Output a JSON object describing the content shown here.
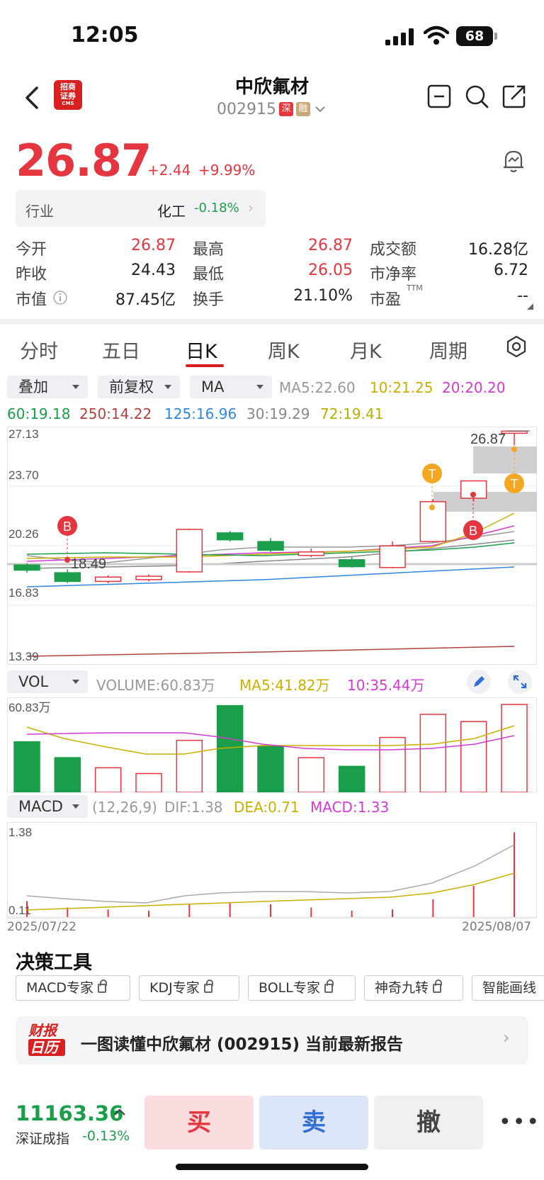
{
  "status": {
    "time": "12:05",
    "battery": "68"
  },
  "header": {
    "logo_top": "招商",
    "logo_mid": "证券",
    "logo_bot": "CMS",
    "title": "中欣氟材",
    "code": "002915",
    "tag1": "深",
    "tag2": "融"
  },
  "quote": {
    "price": "26.87",
    "change": "+2.44",
    "change_pct": "+9.99%"
  },
  "industry": {
    "label": "行业",
    "name": "化工",
    "change": "-0.18%"
  },
  "stats": [
    {
      "k1": "今开",
      "v1": "26.87",
      "k2": "最高",
      "v2": "26.87",
      "k3": "成交额",
      "v3": "16.28亿"
    },
    {
      "k1": "昨收",
      "v1": "24.43",
      "k2": "最低",
      "v2": "26.05",
      "k3": "市净率",
      "v3": "6.72"
    },
    {
      "k1": "市值",
      "v1": "87.45亿",
      "k2": "换手",
      "v2": "21.10%",
      "k3": "市盈",
      "k3sup": "TTM",
      "v3": "--"
    }
  ],
  "tabs": [
    "分时",
    "五日",
    "日K",
    "周K",
    "月K",
    "周期"
  ],
  "controls": {
    "overlay": "叠加",
    "adjust": "前复权",
    "ind": "MA"
  },
  "ma_line1": {
    "ma5": "MA5:22.60",
    "ma10": "10:21.25",
    "ma20": "20:20.20"
  },
  "ma_line2": {
    "ma60": "60:19.18",
    "ma250": "250:14.22",
    "ma125": "125:16.96",
    "ma30": "30:19.29",
    "ma72": "72:19.41"
  },
  "kchart": {
    "y_labels": [
      "27.13",
      "23.70",
      "20.26",
      "16.83",
      "13.39"
    ],
    "high_label": "26.87",
    "low_label": "18.49",
    "marker_b": "B",
    "marker_t": "T"
  },
  "vol": {
    "select": "VOL",
    "volume": "VOLUME:60.83万",
    "ma5": "MA5:41.82万",
    "ma10": "10:35.44万",
    "max_label": "60.83万"
  },
  "macd": {
    "select": "MACD",
    "params": "(12,26,9)",
    "dif": "DIF:1.38",
    "dea": "DEA:0.71",
    "macd": "MACD:1.33",
    "top_label": "1.38",
    "bottom_label": "0.11",
    "date_start": "2025/07/22",
    "date_end": "2025/08/07"
  },
  "tools": {
    "title": "决策工具",
    "items": [
      "MACD专家",
      "KDJ专家",
      "BOLL专家",
      "神奇九转",
      "智能画线"
    ]
  },
  "report": {
    "logo1": "财报",
    "logo2": "日历",
    "text": "一图读懂中欣氟材 (002915) 当前最新报告"
  },
  "index": {
    "value": "11163.36",
    "name": "深证成指",
    "change": "-0.13%"
  },
  "actions": {
    "buy": "买",
    "sell": "卖",
    "cancel": "撤"
  },
  "colors": {
    "up": "#e5353e",
    "down": "#1a9e4a",
    "accent": "#d7201f"
  },
  "chart_data": {
    "type": "candlestick",
    "ylim": [
      13.39,
      27.13
    ],
    "candles": [
      {
        "o": 19.15,
        "c": 18.85,
        "h": 19.25,
        "l": 18.7
      },
      {
        "o": 18.7,
        "c": 18.2,
        "h": 18.9,
        "l": 18.1
      },
      {
        "o": 18.2,
        "c": 18.45,
        "h": 18.55,
        "l": 18.1
      },
      {
        "o": 18.3,
        "c": 18.5,
        "h": 18.6,
        "l": 18.2
      },
      {
        "o": 18.75,
        "c": 21.2,
        "h": 21.25,
        "l": 18.7
      },
      {
        "o": 21.0,
        "c": 20.6,
        "h": 21.1,
        "l": 20.5
      },
      {
        "o": 20.5,
        "c": 20.0,
        "h": 20.7,
        "l": 19.9
      },
      {
        "o": 19.7,
        "c": 19.9,
        "h": 20.1,
        "l": 19.6
      },
      {
        "o": 19.45,
        "c": 19.05,
        "h": 19.6,
        "l": 19.0
      },
      {
        "o": 19.0,
        "c": 20.25,
        "h": 20.5,
        "l": 18.95
      },
      {
        "o": 20.5,
        "c": 22.8,
        "h": 22.95,
        "l": 20.45
      },
      {
        "o": 23.0,
        "c": 24.0,
        "h": 24.0,
        "l": 22.8
      },
      {
        "o": 26.87,
        "c": 26.87,
        "h": 26.87,
        "l": 26.05
      }
    ],
    "volume": [
      35,
      24,
      17,
      13,
      36,
      60,
      32,
      24,
      18,
      38,
      54,
      49,
      60.83
    ],
    "macd_bars": [
      0.25,
      0.15,
      0.12,
      0.1,
      0.2,
      0.22,
      0.2,
      0.15,
      0.1,
      0.12,
      0.28,
      0.49,
      1.33
    ]
  }
}
